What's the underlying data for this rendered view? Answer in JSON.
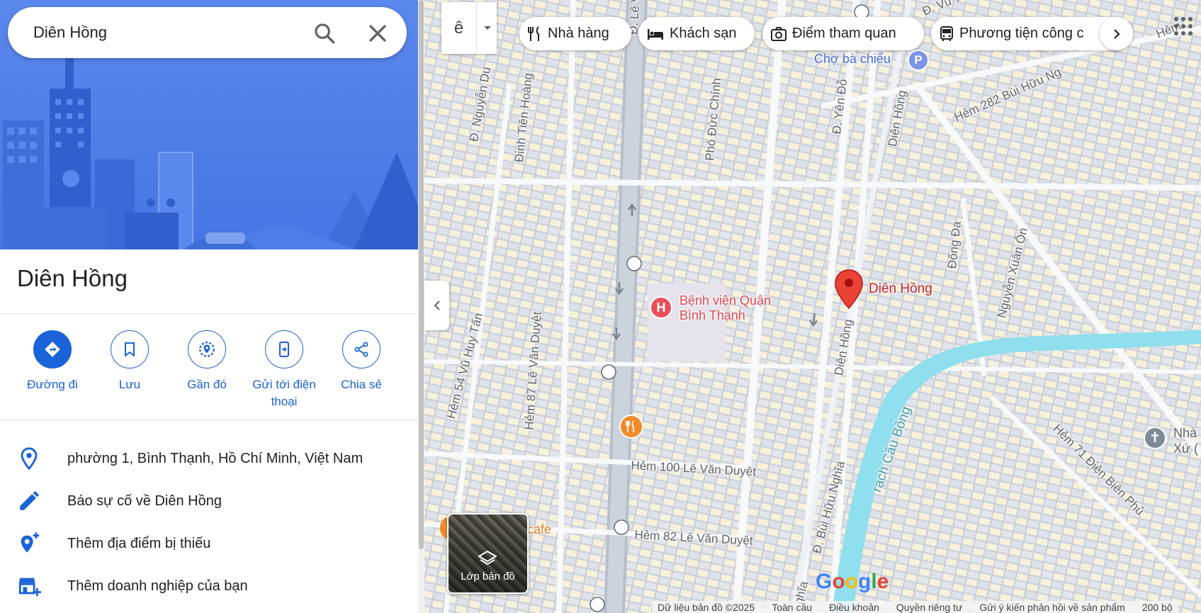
{
  "search": {
    "query": "Diên Hồng"
  },
  "place": {
    "name": "Diên Hồng"
  },
  "actions": [
    {
      "label": "Đường đi",
      "icon": "directions-icon"
    },
    {
      "label": "Lưu",
      "icon": "bookmark-icon"
    },
    {
      "label": "Gần đó",
      "icon": "nearby-icon"
    },
    {
      "label": "Gửi tới điện thoại",
      "icon": "send-to-phone-icon"
    },
    {
      "label": "Chia sẻ",
      "icon": "share-icon"
    }
  ],
  "info": [
    {
      "text": "phường 1, Bình Thạnh, Hồ Chí Minh, Việt Nam",
      "icon": "location-pin-icon"
    },
    {
      "text": "Báo sự cố về Diên Hồng",
      "icon": "edit-pencil-icon"
    },
    {
      "text": "Thêm địa điểm bị thiếu",
      "icon": "add-place-icon"
    },
    {
      "text": "Thêm doanh nghiệp của bạn",
      "icon": "add-business-icon"
    }
  ],
  "map": {
    "lang_button": "ê",
    "chips": [
      "Nhà hàng",
      "Khách sạn",
      "Điểm tham quan",
      "Phương tiện công c"
    ],
    "layers_label": "Lớp bản đồ",
    "google_logo": "Google",
    "marker_label": "Diên Hồng",
    "hospital_label_1": "Bệnh viện Quận",
    "hospital_label_2": "Bình Thạnh",
    "parking_label": "Chợ bà chiểu",
    "cafe_label": "cafe",
    "church_label_1": "Nhà",
    "church_label_2": "Xứ (",
    "streets": {
      "le_van": "Đ. Lê Vă",
      "vu_tu": "Đ. Vũ Tù",
      "hem_top_right": "Hẻm",
      "nguyen_du": "Đ. Nguyễn Du",
      "dinh_tien_hoang": "Đinh Tiên Hoàng",
      "pho_duc_chinh": "Phó Đức Chính",
      "yen_do": "Đ. Yên Đỗ",
      "dien_hong_top": "Diên Hồng",
      "hem_282": "Hẻm 282 Bùi Hữu Ng",
      "dong_da": "Đống Đa",
      "nguyen_xuan_on": "Nguyễn Xuân Ôn",
      "hem_54": "Hẻm 54 Vũ Huy Tấn",
      "hem_87": "Hẻm 87 Lê Văn Duyệt",
      "dien_hong_mid": "Diên Hồng",
      "rach_cau_bong": "rạch Cầu Bông",
      "hem_100": "Hẻm 100 Lê Văn Duyệt",
      "hem_82": "Hẻm 82 Lê Văn Duyệt",
      "bui_huu_nghia": "Đ. Bùi Hữu Nghĩa",
      "hem_71": "Hẻm 71 Điện Biên Phủ",
      "nghia_bottom": "ghĩa"
    },
    "footer": [
      "Dữ liệu bản đồ ©2025",
      "Toàn cầu",
      "Điều khoản",
      "Quyền riêng tư",
      "Gửi ý kiến phản hồi về sản phẩm",
      "200 bộ"
    ]
  },
  "colors": {
    "accent": "#1a63d8",
    "hero_bg": "#4d7ee8",
    "marker": "#ea4335",
    "water": "#8fdfee"
  }
}
